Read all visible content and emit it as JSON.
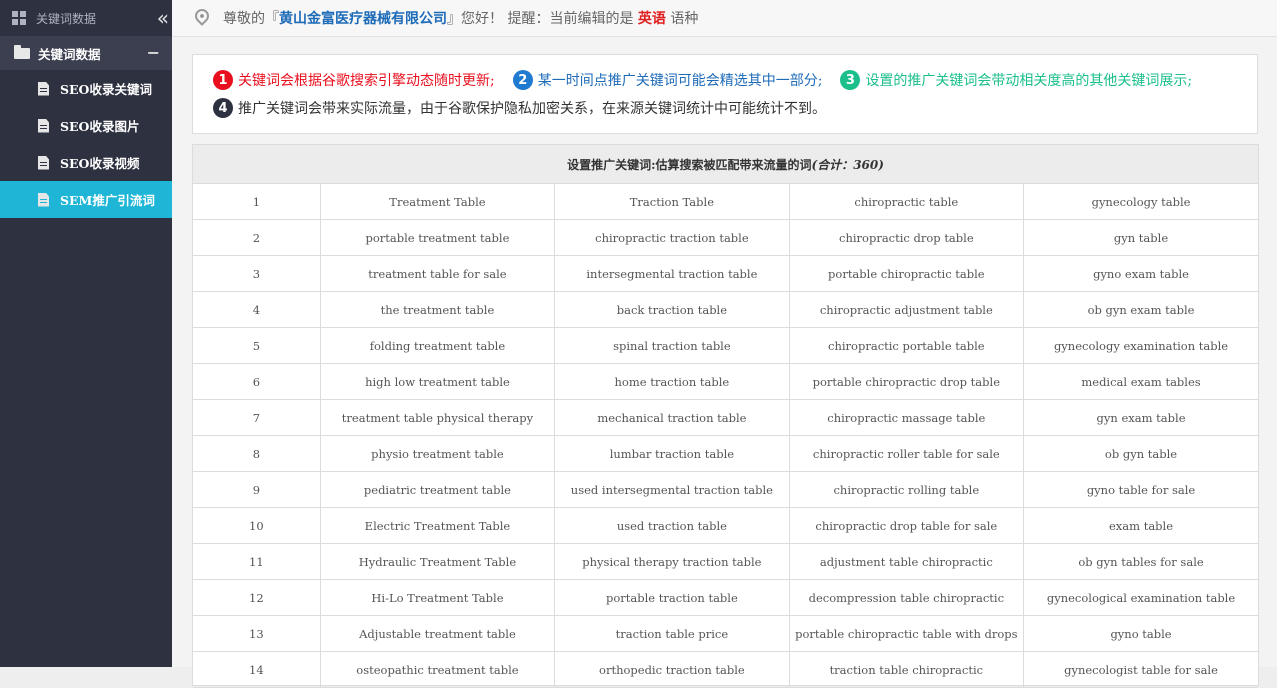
{
  "sidebar": {
    "top_label": "关键词数据",
    "collapse_glyph": "«",
    "group_label": "关键词数据",
    "group_toggle": "−",
    "items": [
      {
        "label": "SEO收录关键词",
        "active": false
      },
      {
        "label": "SEO收录图片",
        "active": false
      },
      {
        "label": "SEO收录视频",
        "active": false
      },
      {
        "label": "SEM推广引流词",
        "active": true
      }
    ]
  },
  "header": {
    "greeting_prefix": "尊敬的『",
    "company": "黄山金富医疗器械有限公司",
    "greeting_suffix": "』您好！ 提醒：当前编辑的是 ",
    "language": "英语",
    "language_suffix": " 语种"
  },
  "notices": [
    {
      "num": "1",
      "text": "关键词会根据谷歌搜索引擎动态随时更新;",
      "color": "#e8101e"
    },
    {
      "num": "2",
      "text": "某一时间点推广关键词可能会精选其中一部分;",
      "color": "#1e6bb8"
    },
    {
      "num": "3",
      "text": "设置的推广关键词会带动相关度高的其他关键词展示;",
      "color": "#1bbf8c"
    },
    {
      "num": "4",
      "text": "推广关键词会带来实际流量，由于谷歌保护隐私加密关系，在来源关键词统计中可能统计不到。",
      "color": "#333333",
      "badge_color": "#2d3140"
    }
  ],
  "table": {
    "title": "设置推广关键词:估算搜索被匹配带来流量的词",
    "title_total": "(合计：360)",
    "rows": [
      [
        "1",
        "Treatment Table",
        "Traction Table",
        "chiropractic table",
        "gynecology table"
      ],
      [
        "2",
        "portable treatment table",
        "chiropractic traction table",
        "chiropractic drop table",
        "gyn table"
      ],
      [
        "3",
        "treatment table for sale",
        "intersegmental traction table",
        "portable chiropractic table",
        "gyno exam table"
      ],
      [
        "4",
        "the treatment table",
        "back traction table",
        "chiropractic adjustment table",
        "ob gyn exam table"
      ],
      [
        "5",
        "folding treatment table",
        "spinal traction table",
        "chiropractic portable table",
        "gynecology examination table"
      ],
      [
        "6",
        "high low treatment table",
        "home traction table",
        "portable chiropractic drop table",
        "medical exam tables"
      ],
      [
        "7",
        "treatment table physical therapy",
        "mechanical traction table",
        "chiropractic massage table",
        "gyn exam table"
      ],
      [
        "8",
        "physio treatment table",
        "lumbar traction table",
        "chiropractic roller table for sale",
        "ob gyn table"
      ],
      [
        "9",
        "pediatric treatment table",
        "used intersegmental traction table",
        "chiropractic rolling table",
        "gyno table for sale"
      ],
      [
        "10",
        "Electric Treatment Table",
        "used traction table",
        "chiropractic drop table for sale",
        "exam table"
      ],
      [
        "11",
        "Hydraulic Treatment Table",
        "physical therapy traction table",
        "adjustment table chiropractic",
        "ob gyn tables for sale"
      ],
      [
        "12",
        "Hi-Lo Treatment Table",
        "portable traction table",
        "decompression table chiropractic",
        "gynecological examination table"
      ],
      [
        "13",
        "Adjustable treatment table",
        "traction table price",
        "portable chiropractic table with drops",
        "gyno table"
      ],
      [
        "14",
        "osteopathic treatment table",
        "orthopedic traction table",
        "traction table chiropractic",
        "gynecologist table for sale"
      ]
    ]
  }
}
